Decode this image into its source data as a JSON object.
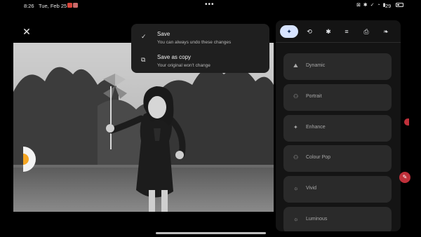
{
  "status_bar": {
    "time": "8:26",
    "date": "Tue, Feb 25",
    "more": "•••",
    "icons": "⊠ ✱ ✓ ◔ ▮",
    "battery": "29"
  },
  "editor": {
    "close_icon": "✕"
  },
  "save_menu": {
    "save_title": "Save",
    "save_subtitle": "You can always undo these changes",
    "save_icon": "✓",
    "copy_title": "Save as copy",
    "copy_subtitle": "Your original won't change",
    "copy_icon": "⧉"
  },
  "tools": [
    {
      "name": "suggestions",
      "glyph": "✦"
    },
    {
      "name": "crop",
      "glyph": "⟲"
    },
    {
      "name": "tools",
      "glyph": "✱"
    },
    {
      "name": "adjust",
      "glyph": "≡"
    },
    {
      "name": "markup",
      "glyph": "⎙"
    },
    {
      "name": "filters",
      "glyph": "❧"
    }
  ],
  "suggestions": [
    {
      "icon": "⛰",
      "label": "Dynamic"
    },
    {
      "icon": "⚇",
      "label": "Portrait"
    },
    {
      "icon": "✦",
      "label": "Enhance"
    },
    {
      "icon": "⚇",
      "label": "Colour Pop"
    },
    {
      "icon": "☼",
      "label": "Vivid"
    },
    {
      "icon": "☼",
      "label": "Luminous"
    }
  ],
  "colors": {
    "accent": "#d7e3ff",
    "side_accent": "#c0303a",
    "crop_handle": "#f5a623"
  }
}
